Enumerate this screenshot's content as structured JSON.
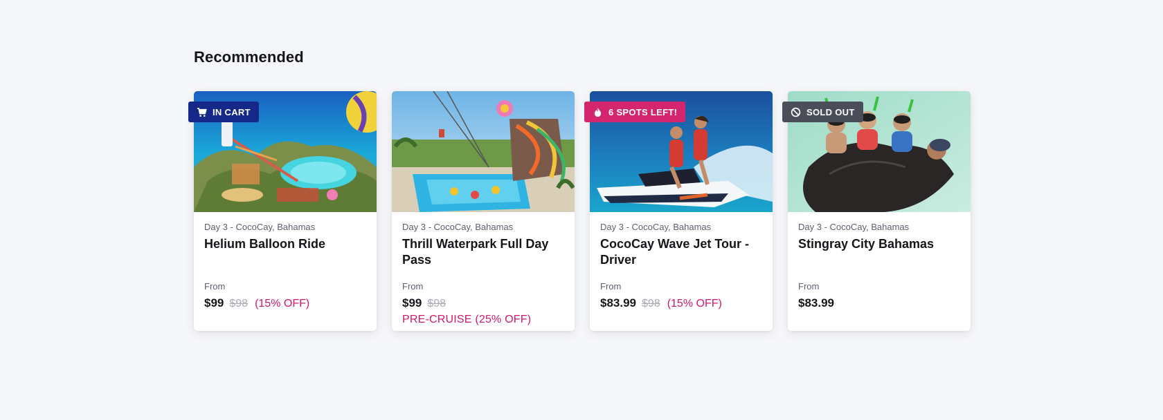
{
  "section": {
    "title": "Recommended"
  },
  "colors": {
    "in_cart": "#15288a",
    "spots_left": "#d4266e",
    "sold_out": "#4a4e58",
    "discount": "#d4176b"
  },
  "cards": [
    {
      "badge": {
        "label": "IN CART",
        "icon": "cart-icon"
      },
      "location": "Day 3 - CocoCay, Bahamas",
      "title": "Helium Balloon Ride",
      "from_label": "From",
      "price": "$99",
      "old_price": "$98",
      "discount": "(15% OFF)",
      "precruise": ""
    },
    {
      "location": "Day 3 - CocoCay, Bahamas",
      "title": "Thrill Waterpark Full Day Pass",
      "from_label": "From",
      "price": "$99",
      "old_price": "$98",
      "discount": "",
      "precruise": "PRE-CRUISE (25% OFF)"
    },
    {
      "badge": {
        "label": "6 SPOTS LEFT!",
        "icon": "flame-icon"
      },
      "location": "Day 3 - CocoCay, Bahamas",
      "title": "CocoCay Wave Jet Tour - Driver",
      "from_label": "From",
      "price": "$83.99",
      "old_price": "$98",
      "discount": "(15% OFF)",
      "precruise": ""
    },
    {
      "badge": {
        "label": "SOLD OUT",
        "icon": "ban-icon"
      },
      "location": "Day 3 - CocoCay, Bahamas",
      "title": "Stingray City Bahamas",
      "from_label": "From",
      "price": "$83.99",
      "old_price": "",
      "discount": "",
      "precruise": ""
    }
  ]
}
